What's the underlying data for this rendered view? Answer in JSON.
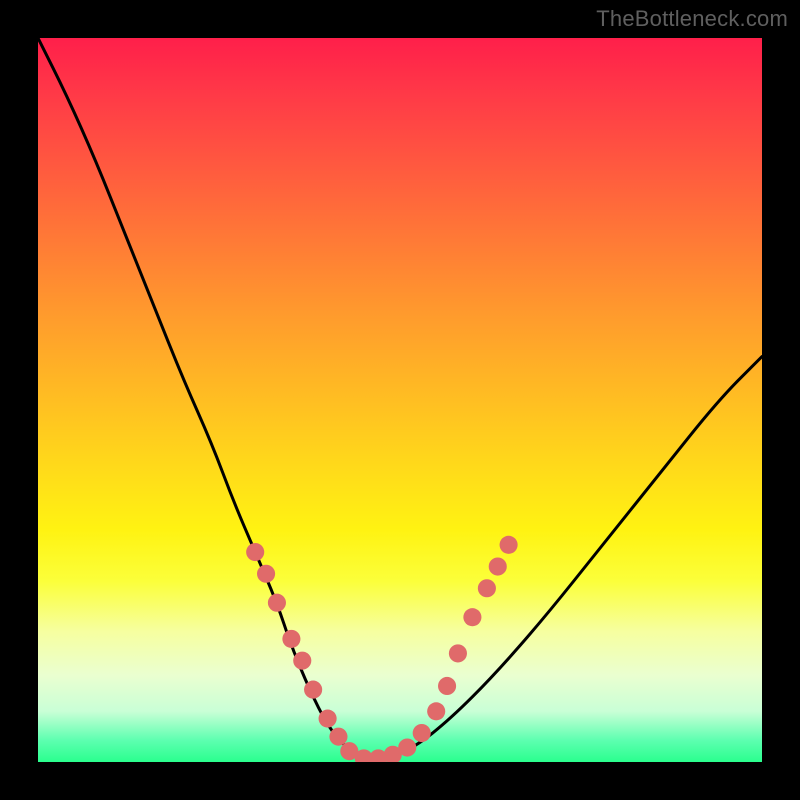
{
  "attribution": "TheBottleneck.com",
  "chart_data": {
    "type": "line",
    "title": "",
    "xlabel": "",
    "ylabel": "",
    "xlim": [
      0,
      100
    ],
    "ylim": [
      0,
      100
    ],
    "background_gradient": {
      "orientation": "vertical",
      "stops": [
        {
          "pos": 0.0,
          "color": "#ff1f4a"
        },
        {
          "pos": 0.18,
          "color": "#ff5a3f"
        },
        {
          "pos": 0.38,
          "color": "#ff9a2d"
        },
        {
          "pos": 0.58,
          "color": "#ffd61b"
        },
        {
          "pos": 0.75,
          "color": "#fbff3a"
        },
        {
          "pos": 0.88,
          "color": "#eaffd0"
        },
        {
          "pos": 1.0,
          "color": "#2aff8e"
        }
      ]
    },
    "series": [
      {
        "name": "curve",
        "color": "#000000",
        "x": [
          0,
          4,
          8,
          12,
          16,
          20,
          24,
          27,
          30,
          33,
          35,
          37.5,
          40,
          42.5,
          45,
          48,
          52,
          57,
          63,
          70,
          78,
          86,
          94,
          100
        ],
        "values": [
          100,
          92,
          83,
          73,
          63,
          53,
          44,
          36,
          29,
          22,
          16,
          10,
          5,
          2,
          0.5,
          0.5,
          2,
          6,
          12,
          20,
          30,
          40,
          50,
          56
        ]
      }
    ],
    "markers": {
      "color": "#e06a6a",
      "radius_pct": 1.25,
      "points": [
        {
          "x": 30,
          "y": 29
        },
        {
          "x": 31.5,
          "y": 26
        },
        {
          "x": 33,
          "y": 22
        },
        {
          "x": 35,
          "y": 17
        },
        {
          "x": 36.5,
          "y": 14
        },
        {
          "x": 38,
          "y": 10
        },
        {
          "x": 40,
          "y": 6
        },
        {
          "x": 41.5,
          "y": 3.5
        },
        {
          "x": 43,
          "y": 1.5
        },
        {
          "x": 45,
          "y": 0.5
        },
        {
          "x": 47,
          "y": 0.5
        },
        {
          "x": 49,
          "y": 1
        },
        {
          "x": 51,
          "y": 2
        },
        {
          "x": 53,
          "y": 4
        },
        {
          "x": 55,
          "y": 7
        },
        {
          "x": 56.5,
          "y": 10.5
        },
        {
          "x": 58,
          "y": 15
        },
        {
          "x": 60,
          "y": 20
        },
        {
          "x": 62,
          "y": 24
        },
        {
          "x": 63.5,
          "y": 27
        },
        {
          "x": 65,
          "y": 30
        }
      ]
    }
  }
}
